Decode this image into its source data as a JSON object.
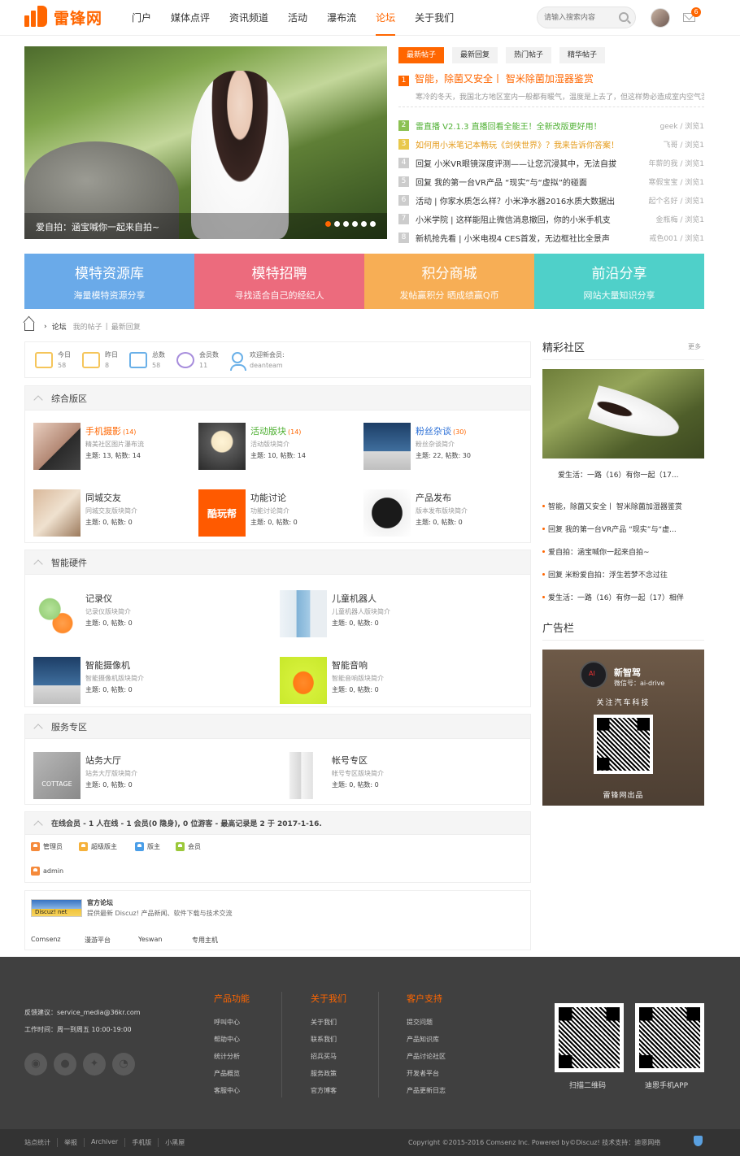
{
  "header": {
    "logo_text": "雷锋网",
    "nav": [
      "门户",
      "媒体点评",
      "资讯频道",
      "活动",
      "瀑布流",
      "论坛",
      "关于我们"
    ],
    "active_nav": "论坛",
    "search_placeholder": "请输入搜索内容",
    "notification_count": "6"
  },
  "slider": {
    "caption": "爱自拍：涵宝喊你一起来自拍~",
    "slide_count": 6,
    "active_slide": 1
  },
  "posts": {
    "tabs": [
      "最新帖子",
      "最新回复",
      "热门帖子",
      "精华帖子"
    ],
    "active_tab": "最新帖子",
    "featured": {
      "num": "1",
      "title": "智能，除菌又安全丨 智米除菌加湿器鉴赏",
      "desc": "寒冷的冬天，我国北方地区室内一般都有暖气，温度是上去了，但这样势必造成室内空气湿度"
    },
    "list": [
      {
        "num": "2",
        "title": "雷直播 V2.1.3 直播回看全能王！全新改版更好用！",
        "meta": "geek / 浏览1",
        "style": "g"
      },
      {
        "num": "3",
        "title": "如何用小米笔记本畅玩《剑侠世界》？我来告诉你答案！",
        "meta": "飞哥 / 浏览1",
        "style": "y"
      },
      {
        "num": "4",
        "title": "回复 小米VR眼镜深度评测——让您沉浸其中，无法自拔",
        "meta": "年薪的我 / 浏览1",
        "style": ""
      },
      {
        "num": "5",
        "title": "回复 我的第一台VR产品 “现实”与“虚拟”的碰面",
        "meta": "寒假宝宝 / 浏览1",
        "style": ""
      },
      {
        "num": "6",
        "title": "活动 | 你家水质怎么样？小米净水器2016水质大数据出",
        "meta": "起个名好 / 浏览1",
        "style": ""
      },
      {
        "num": "7",
        "title": "小米学院 | 这样能阻止微信消息撤回，你的小米手机支",
        "meta": "金瓶梅 / 浏览1",
        "style": ""
      },
      {
        "num": "8",
        "title": "新机抢先看 | 小米电视4 CES首发，无边框社比全景声",
        "meta": "戒色001 / 浏览1",
        "style": ""
      }
    ]
  },
  "banners": [
    {
      "title": "模特资源库",
      "sub": "海量模特资源分享",
      "color": "#6aaae9"
    },
    {
      "title": "模特招聘",
      "sub": "寻找适合自己的经纪人",
      "color": "#ec6b7d"
    },
    {
      "title": "积分商城",
      "sub": "发帖赢积分 晒成绩赢Q币",
      "color": "#f7ae55"
    },
    {
      "title": "前沿分享",
      "sub": "网站大量知识分享",
      "color": "#4fd0c9"
    }
  ],
  "breadcrumb": {
    "current": "论坛",
    "links": [
      "我的帖子",
      "最新回复"
    ]
  },
  "stats": [
    {
      "label": "今日",
      "value": "58"
    },
    {
      "label": "昨日",
      "value": "8"
    },
    {
      "label": "总数",
      "value": "58"
    },
    {
      "label": "会员数",
      "value": "11"
    },
    {
      "label": "欢迎新会员:",
      "value": "deanteam"
    }
  ],
  "sections": [
    {
      "title": "综合版区",
      "forums": [
        {
          "name": "手机摄影",
          "count": "(14)",
          "desc": "精美社区图片瀑布流",
          "stat": "主题: 13, 帖数: 14",
          "color": "#f60"
        },
        {
          "name": "活动版块",
          "count": "(14)",
          "desc": "活动版块简介",
          "stat": "主题: 10, 帖数: 14",
          "color": "#4daf31"
        },
        {
          "name": "粉丝杂谈",
          "count": "(30)",
          "desc": "粉丝杂谈简介",
          "stat": "主题: 22, 帖数: 30",
          "color": "#2b6fd6"
        },
        {
          "name": "同城交友",
          "count": "",
          "desc": "同城交友版块简介",
          "stat": "主题: 0, 帖数: 0",
          "color": "#333"
        },
        {
          "name": "功能讨论",
          "count": "",
          "desc": "功能讨论简介",
          "stat": "主题: 0, 帖数: 0",
          "color": "#333"
        },
        {
          "name": "产品发布",
          "count": "",
          "desc": "版本发布版块简介",
          "stat": "主题: 0, 帖数: 0",
          "color": "#333"
        }
      ]
    },
    {
      "title": "智能硬件",
      "forums": [
        {
          "name": "记录仪",
          "desc": "记录仪版块简介",
          "stat": "主题: 0, 帖数: 0"
        },
        {
          "name": "儿童机器人",
          "desc": "儿童机器人版块简介",
          "stat": "主题: 0, 帖数: 0"
        },
        {
          "name": "智能摄像机",
          "desc": "智能摄像机版块简介",
          "stat": "主题: 0, 帖数: 0"
        },
        {
          "name": "智能音响",
          "desc": "智能音响版块简介",
          "stat": "主题: 0, 帖数: 0"
        }
      ]
    },
    {
      "title": "服务专区",
      "forums": [
        {
          "name": "站务大厅",
          "desc": "站务大厅版块简介",
          "stat": "主题: 0, 帖数: 0"
        },
        {
          "name": "帐号专区",
          "desc": "帐号专区版块简介",
          "stat": "主题: 0, 帖数: 0"
        }
      ]
    }
  ],
  "thumb_labels": {
    "gongneng": "酷玩帮",
    "cottage": "COTTAGE"
  },
  "online": {
    "summary": "在线会员 - 1 人在线 - 1 会员(0 隐身), 0 位游客 - 最高记录是 2 于 2017-1-16.",
    "legend": [
      "管理员",
      "超级版主",
      "版主",
      "会员"
    ],
    "users": [
      "admin"
    ]
  },
  "links": {
    "logo_text": "Discuz! net",
    "title": "官方论坛",
    "desc": "提供最新 Discuz! 产品新闻、软件下载与技术交流",
    "items": [
      "Comsenz",
      "漫游平台",
      "Yeswan",
      "专用主机"
    ]
  },
  "sidebar": {
    "community_title": "精彩社区",
    "more": "更多",
    "image_caption": "爱生活：一路（16）有你一起（17...",
    "items": [
      "智能，除菌又安全丨 智米除菌加湿器鉴赏",
      "回复 我的第一台VR产品 “现实”与“虚...",
      "爱自拍：涵宝喊你一起来自拍~",
      "回复 米粉爱自拍：浮生若梦不念过往",
      "爱生活：一路（16）有你一起（17）相伴"
    ],
    "ad_title": "广告栏",
    "ad": {
      "name": "新智驾",
      "wechat": "微信号：ai-drive",
      "tagline": "关注汽车科技",
      "footer": "雷锋网出品"
    }
  },
  "footer": {
    "feedback": "反馈建议：service_media@36kr.com",
    "hours": "工作时间：周一到周五 10:00-19:00",
    "social_icons": [
      "weibo-icon",
      "wechat-icon",
      "twitter-icon",
      "rss-icon"
    ],
    "columns": [
      {
        "title": "产品功能",
        "links": [
          "呼叫中心",
          "帮助中心",
          "统计分析",
          "产品概览",
          "客服中心"
        ]
      },
      {
        "title": "关于我们",
        "links": [
          "关于我们",
          "联系我们",
          "招兵买马",
          "服务政策",
          "官方博客"
        ]
      },
      {
        "title": "客户支持",
        "links": [
          "提交问题",
          "产品知识库",
          "产品讨论社区",
          "开发者平台",
          "产品更新日志"
        ]
      }
    ],
    "qr_captions": [
      "扫描二维码",
      "迪恩手机APP"
    ],
    "bottom_links": [
      "站点统计",
      "举报",
      "Archiver",
      "手机版",
      "小黑屋"
    ],
    "copyright": "Copyright  ©2015-2016  Comsenz Inc.  Powered by©Discuz!  技术支持：迪恩网络"
  },
  "colors": {
    "accent": "#ff6600",
    "footer_bg": "#404040"
  }
}
